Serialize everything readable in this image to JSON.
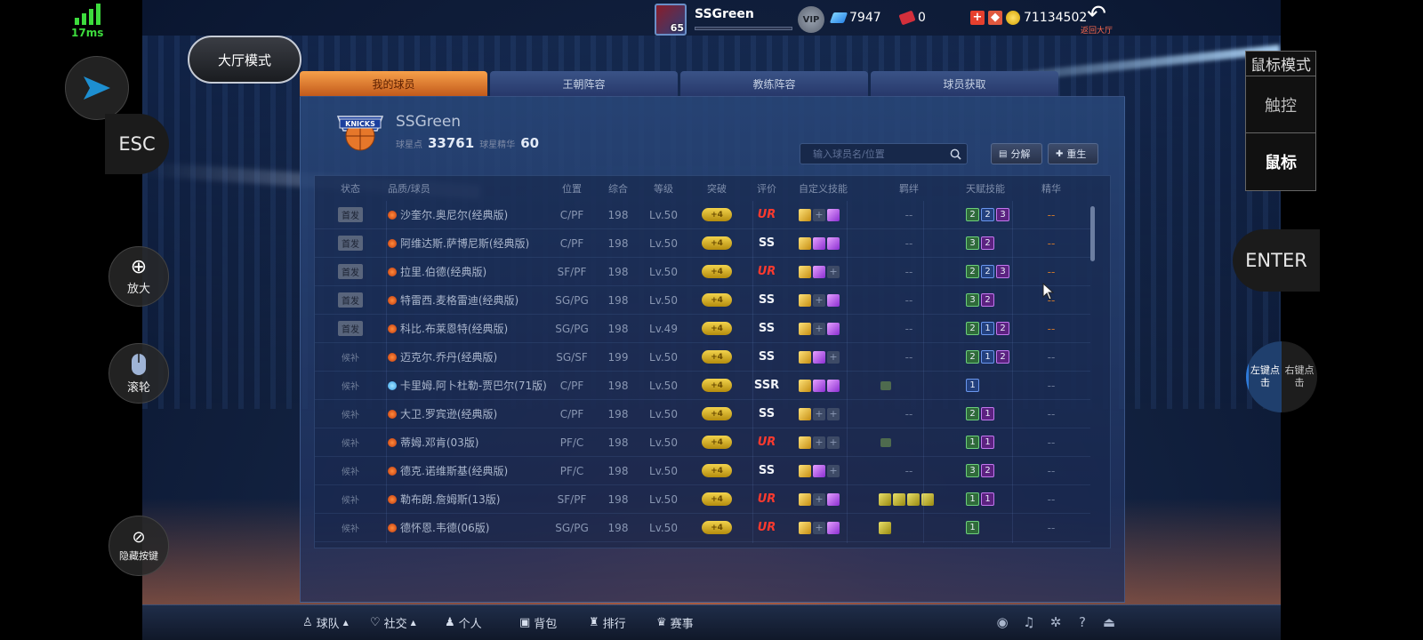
{
  "network": {
    "latency": "17ms"
  },
  "left_controls": {
    "esc_label": "ESC",
    "zoom_label": "放大",
    "scroll_label": "滚轮",
    "hide_keys_label": "隐藏按键"
  },
  "right_controls": {
    "mode_title": "鼠标模式",
    "touch_label": "触控",
    "mouse_label": "鼠标",
    "enter_label": "ENTER",
    "left_click_label": "左键点击",
    "right_click_label": "右键点击"
  },
  "topbar": {
    "avatar_level": "65",
    "username": "SSGreen",
    "vip_label": "VIP",
    "diamonds": "7947",
    "tickets": "0",
    "coins": "71134502",
    "back_label": "返回大厅"
  },
  "hall_mode_label": "大厅模式",
  "tabs": [
    {
      "label": "我的球员",
      "active": true
    },
    {
      "label": "王朝阵容",
      "active": false
    },
    {
      "label": "教练阵容",
      "active": false
    },
    {
      "label": "球员获取",
      "active": false
    }
  ],
  "team": {
    "name": "SSGreen",
    "star_points_label": "球星点",
    "star_points": "33761",
    "essence_label": "球星精华",
    "essence": "60"
  },
  "search": {
    "placeholder": "输入球员名/位置"
  },
  "buttons": {
    "decompose": "分解",
    "rebirth": "重生"
  },
  "table": {
    "headers": [
      "状态",
      "品质/球员",
      "位置",
      "综合",
      "等级",
      "突破",
      "评价",
      "自定义技能",
      "羁绊",
      "天赋技能",
      "精华"
    ],
    "rows": [
      {
        "status": "首发",
        "starter": true,
        "dot": "orange",
        "name": "沙奎尔.奥尼尔(经典版)",
        "pos": "C/PF",
        "ovr": "198",
        "lvl": "Lv.50",
        "break": "+4",
        "grade": "UR",
        "skills": [
          "gold",
          "plus",
          "purple"
        ],
        "bond": "--",
        "talent": [
          [
            "2",
            "green"
          ],
          [
            "2",
            "blue"
          ],
          [
            "3",
            "purple"
          ]
        ],
        "essence": "--"
      },
      {
        "status": "首发",
        "starter": true,
        "dot": "orange",
        "name": "阿维达斯.萨博尼斯(经典版)",
        "pos": "C/PF",
        "ovr": "198",
        "lvl": "Lv.50",
        "break": "+4",
        "grade": "SS",
        "skills": [
          "gold",
          "purple",
          "purple"
        ],
        "bond": "--",
        "talent": [
          [
            "3",
            "green"
          ],
          [
            "2",
            "purple"
          ]
        ],
        "essence": "--"
      },
      {
        "status": "首发",
        "starter": true,
        "dot": "orange",
        "name": "拉里.伯德(经典版)",
        "pos": "SF/PF",
        "ovr": "198",
        "lvl": "Lv.50",
        "break": "+4",
        "grade": "UR",
        "skills": [
          "gold",
          "purple",
          "plus"
        ],
        "bond": "--",
        "talent": [
          [
            "2",
            "green"
          ],
          [
            "2",
            "blue"
          ],
          [
            "3",
            "purple"
          ]
        ],
        "essence": "--"
      },
      {
        "status": "首发",
        "starter": true,
        "dot": "orange",
        "name": "特雷西.麦格雷迪(经典版)",
        "pos": "SG/PG",
        "ovr": "198",
        "lvl": "Lv.50",
        "break": "+4",
        "grade": "SS",
        "skills": [
          "gold",
          "plus",
          "purple"
        ],
        "bond": "--",
        "talent": [
          [
            "3",
            "green"
          ],
          [
            "2",
            "purple"
          ]
        ],
        "essence": "--"
      },
      {
        "status": "首发",
        "starter": true,
        "dot": "orange",
        "name": "科比.布莱恩特(经典版)",
        "pos": "SG/PG",
        "ovr": "198",
        "lvl": "Lv.49",
        "break": "+4",
        "grade": "SS",
        "skills": [
          "gold",
          "plus",
          "purple"
        ],
        "bond": "--",
        "talent": [
          [
            "2",
            "green"
          ],
          [
            "1",
            "blue"
          ],
          [
            "2",
            "purple"
          ]
        ],
        "essence": "--"
      },
      {
        "status": "候补",
        "starter": false,
        "dot": "orange",
        "name": "迈克尔.乔丹(经典版)",
        "pos": "SG/SF",
        "ovr": "199",
        "lvl": "Lv.50",
        "break": "+4",
        "grade": "SS",
        "skills": [
          "gold",
          "purple",
          "plus"
        ],
        "bond": "--",
        "talent": [
          [
            "2",
            "green"
          ],
          [
            "1",
            "blue"
          ],
          [
            "2",
            "purple"
          ]
        ],
        "essence": "--"
      },
      {
        "status": "候补",
        "starter": false,
        "dot": "blue",
        "name": "卡里姆.阿卜杜勒-贾巴尔(71版)",
        "pos": "C/PF",
        "ovr": "198",
        "lvl": "Lv.50",
        "break": "+4",
        "grade": "SSR",
        "skills": [
          "gold",
          "purple",
          "purple"
        ],
        "bond": "",
        "talent": [
          [
            "1",
            "blue"
          ]
        ],
        "essence": "--"
      },
      {
        "status": "候补",
        "starter": false,
        "dot": "orange",
        "name": "大卫.罗宾逊(经典版)",
        "pos": "C/PF",
        "ovr": "198",
        "lvl": "Lv.50",
        "break": "+4",
        "grade": "SS",
        "skills": [
          "gold",
          "plus",
          "plus"
        ],
        "bond": "--",
        "talent": [
          [
            "2",
            "green"
          ],
          [
            "1",
            "purple"
          ]
        ],
        "essence": "--"
      },
      {
        "status": "候补",
        "starter": false,
        "dot": "orange",
        "name": "蒂姆.邓肯(03版)",
        "pos": "PF/C",
        "ovr": "198",
        "lvl": "Lv.50",
        "break": "+4",
        "grade": "UR",
        "skills": [
          "gold",
          "plus",
          "plus"
        ],
        "bond": "",
        "talent": [
          [
            "1",
            "green"
          ],
          [
            "1",
            "purple"
          ]
        ],
        "essence": "--"
      },
      {
        "status": "候补",
        "starter": false,
        "dot": "orange",
        "name": "德克.诺维斯基(经典版)",
        "pos": "PF/C",
        "ovr": "198",
        "lvl": "Lv.50",
        "break": "+4",
        "grade": "SS",
        "skills": [
          "gold",
          "purple",
          "plus"
        ],
        "bond": "--",
        "talent": [
          [
            "3",
            "green"
          ],
          [
            "2",
            "purple"
          ]
        ],
        "essence": "--"
      },
      {
        "status": "候补",
        "starter": false,
        "dot": "orange",
        "name": "勒布朗.詹姆斯(13版)",
        "pos": "SF/PF",
        "ovr": "198",
        "lvl": "Lv.50",
        "break": "+4",
        "grade": "UR",
        "skills": [
          "gold",
          "plus",
          "purple"
        ],
        "bond": "icons4",
        "talent": [
          [
            "1",
            "green"
          ],
          [
            "1",
            "purple"
          ]
        ],
        "essence": "--"
      },
      {
        "status": "候补",
        "starter": false,
        "dot": "orange",
        "name": "德怀恩.韦德(06版)",
        "pos": "SG/PG",
        "ovr": "198",
        "lvl": "Lv.50",
        "break": "+4",
        "grade": "UR",
        "skills": [
          "gold",
          "plus",
          "purple"
        ],
        "bond": "icons1",
        "talent": [
          [
            "1",
            "green"
          ]
        ],
        "essence": "--"
      }
    ]
  },
  "bottombar": {
    "team": "球队",
    "social": "社交",
    "personal": "个人",
    "bag": "背包",
    "rank": "排行",
    "match": "赛事"
  },
  "colors": {
    "accent_tab": "#f7a04a",
    "ur_grade": "#ff3a2e",
    "net_green": "#3ddc3d"
  }
}
